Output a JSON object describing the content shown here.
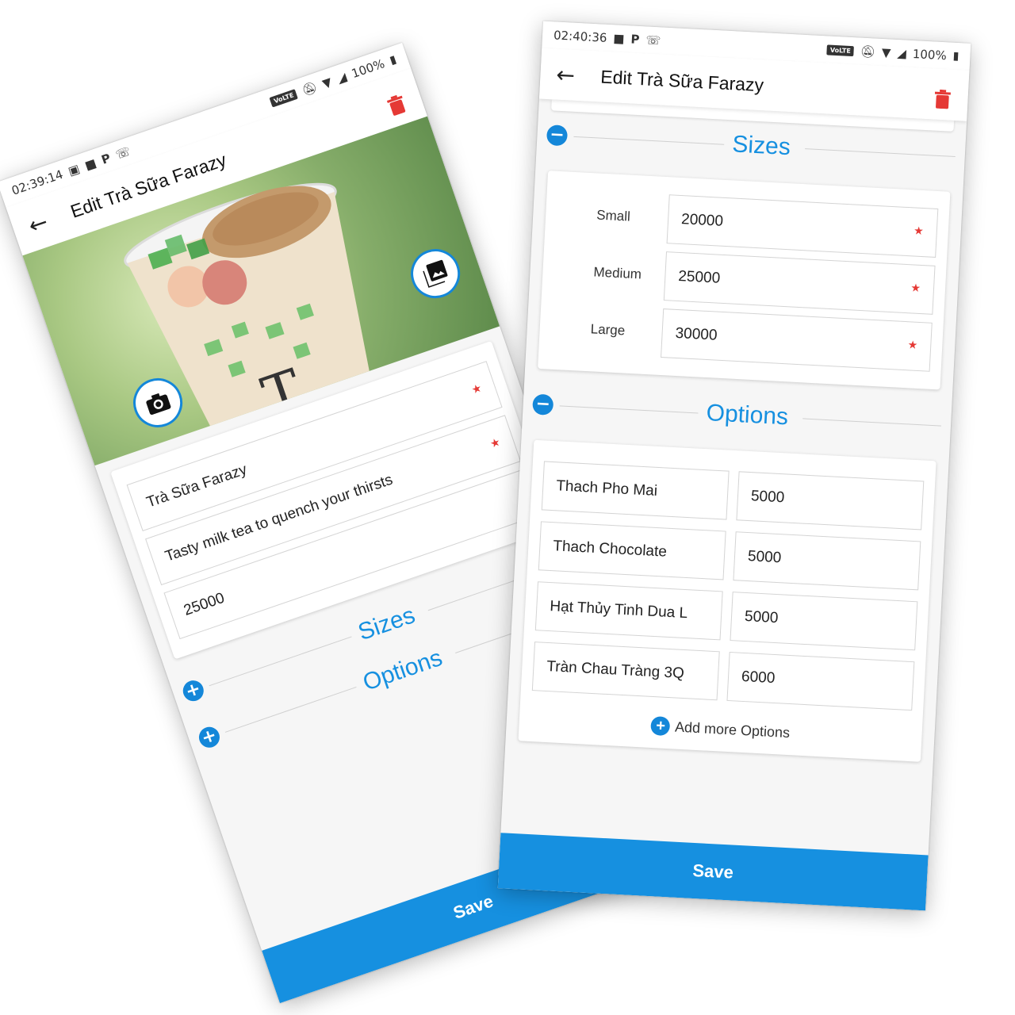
{
  "left": {
    "status": {
      "time": "02:39:14",
      "battery": "100%",
      "volte": "VoLTE"
    },
    "title": "Edit Trà Sữa Farazy",
    "fields": {
      "name": "Trà Sữa Farazy",
      "description": "Tasty milk tea to quench your thirsts",
      "price": "25000"
    },
    "sections": {
      "sizes": "Sizes",
      "options": "Options"
    },
    "save_label": "Save"
  },
  "right": {
    "status": {
      "time": "02:40:36",
      "battery": "100%",
      "volte": "VoLTE"
    },
    "title": "Edit Trà Sữa Farazy",
    "sizes_title": "Sizes",
    "sizes": [
      {
        "label": "Small",
        "value": "20000"
      },
      {
        "label": "Medium",
        "value": "25000"
      },
      {
        "label": "Large",
        "value": "30000"
      }
    ],
    "options_title": "Options",
    "options": [
      {
        "name": "Thach Pho Mai",
        "price": "5000"
      },
      {
        "name": "Thach Chocolate",
        "price": "5000"
      },
      {
        "name": "Hạt Thủy Tinh Dua L",
        "price": "5000"
      },
      {
        "name": "Tràn Chau Tràng 3Q",
        "price": "6000"
      }
    ],
    "add_more_label": "Add more Options",
    "save_label": "Save"
  },
  "colors": {
    "accent": "#1690e0",
    "required": "#e53935",
    "delete": "#e53935"
  },
  "icons": {
    "back": "arrow-left-icon",
    "delete": "trash-icon",
    "camera": "camera-icon",
    "gallery": "gallery-icon",
    "expand": "plus-circle-icon",
    "collapse": "minus-circle-icon"
  }
}
